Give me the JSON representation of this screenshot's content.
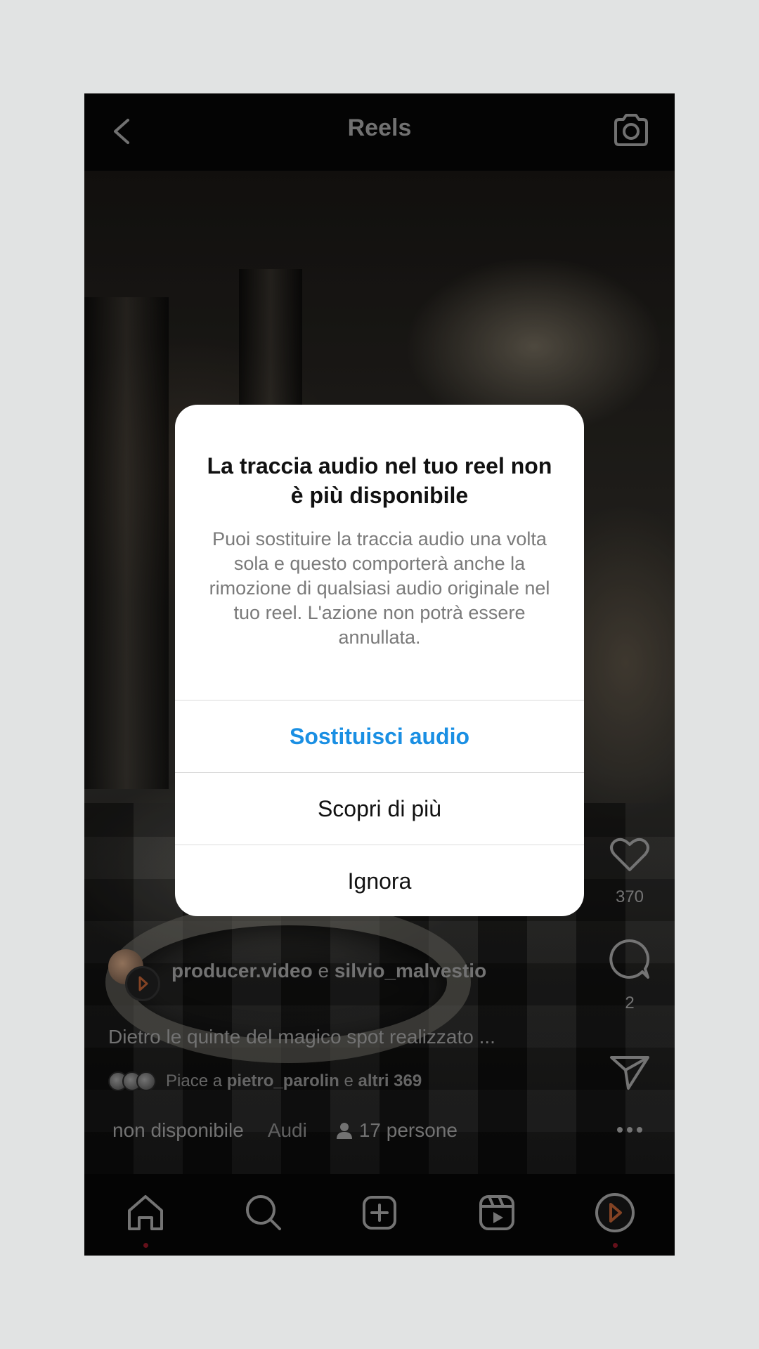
{
  "header": {
    "title": "Reels",
    "back_icon": "chevron-left-icon",
    "camera_icon": "camera-icon"
  },
  "actions": {
    "likes_count": "370",
    "comments_count": "2"
  },
  "post": {
    "user1": "producer.video",
    "connector": "e",
    "user2": "silvio_malvestio",
    "caption": "Dietro le quinte del magico spot realizzato ...",
    "likes_prefix": "Piace a",
    "likes_user": "pietro_parolin",
    "likes_connector": "e",
    "likes_others": "altri 369",
    "audio_text": "non disponibile",
    "audio_text_2": "Audi",
    "people_text": "17 persone"
  },
  "dialog": {
    "title": "La traccia audio nel tuo reel non è più disponibile",
    "body": "Puoi sostituire la traccia audio una volta sola e questo comporterà anche la rimozione di qualsiasi audio originale nel tuo reel. L'azione non potrà essere annullata.",
    "primary_label": "Sostituisci audio",
    "learn_more_label": "Scopri di più",
    "ignore_label": "Ignora"
  },
  "colors": {
    "primary_button": "#1a8fe3",
    "notification_dot": "#7a1420",
    "background": "#e1e3e3"
  },
  "bottom_nav": [
    "home-icon",
    "search-icon",
    "create-icon",
    "reels-icon",
    "profile-icon"
  ]
}
